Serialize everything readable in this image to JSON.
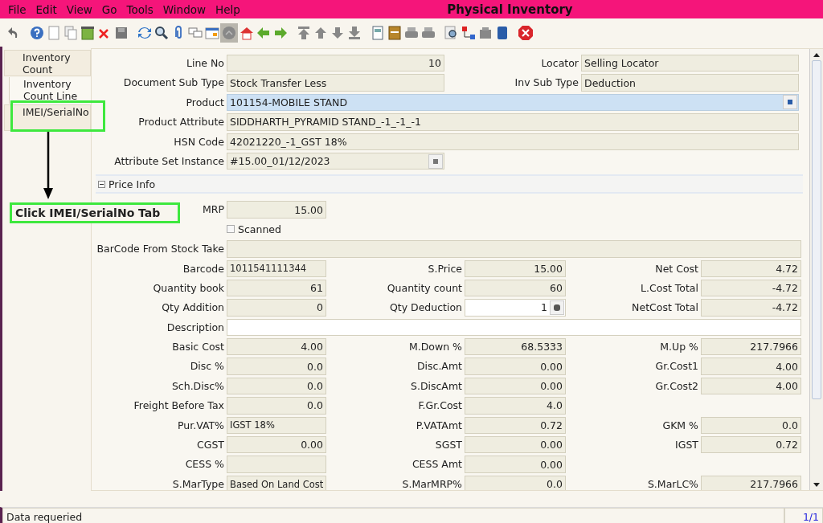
{
  "window": {
    "title": "Physical Inventory"
  },
  "menu": [
    {
      "label": "File"
    },
    {
      "label": "Edit"
    },
    {
      "label": "View"
    },
    {
      "label": "Go"
    },
    {
      "label": "Tools"
    },
    {
      "label": "Window"
    },
    {
      "label": "Help"
    }
  ],
  "toolbar": {
    "buttons": [
      {
        "pressed": false
      },
      {
        "pressed": false
      },
      {
        "pressed": false
      },
      {
        "pressed": false
      },
      {
        "pressed": false
      },
      {
        "pressed": false
      },
      {
        "pressed": false
      },
      {
        "pressed": false
      },
      {
        "pressed": false
      },
      {
        "pressed": false
      },
      {
        "pressed": false
      },
      {
        "pressed": false
      },
      {
        "pressed": true
      },
      {
        "pressed": false
      },
      {
        "pressed": false
      },
      {
        "pressed": false
      },
      {
        "pressed": false
      },
      {
        "pressed": false
      },
      {
        "pressed": false
      },
      {
        "pressed": false
      },
      {
        "pressed": false
      },
      {
        "pressed": false
      },
      {
        "pressed": false
      },
      {
        "pressed": false
      },
      {
        "pressed": false
      },
      {
        "pressed": false
      },
      {
        "pressed": false
      },
      {
        "pressed": false
      },
      {
        "pressed": false
      }
    ]
  },
  "tabs": [
    {
      "label": "Inventory Count",
      "selected": false
    },
    {
      "label": "Inventory Count Line",
      "selected": true
    },
    {
      "label": "IMEI/SerialNo",
      "selected": false
    }
  ],
  "annotation": {
    "text": "Click IMEI/SerialNo Tab"
  },
  "form": {
    "top_rows": [
      {
        "left": {
          "label": "Line No",
          "value": "10",
          "kind": "number",
          "editable": false
        },
        "right": {
          "label": "Locator",
          "value": "Selling Locator",
          "kind": "text",
          "editable": false
        }
      },
      {
        "left": {
          "label": "Document Sub Type",
          "value": "Stock Transfer Less",
          "kind": "text",
          "editable": false
        },
        "right": {
          "label": "Inv Sub Type",
          "value": "Deduction",
          "kind": "text",
          "editable": false
        }
      },
      {
        "left": {
          "label": "Product",
          "value": "101154-MOBILE STAND",
          "kind": "lookup",
          "editable": false,
          "focused": true,
          "wide": true
        }
      },
      {
        "left": {
          "label": "Product Attribute",
          "value": "SIDDHARTH_PYRAMID STAND_-1_-1_-1",
          "kind": "text",
          "editable": false,
          "wide": true
        }
      },
      {
        "left": {
          "label": "HSN Code",
          "value": "42021220_-1_GST 18%",
          "kind": "text",
          "editable": false,
          "wide": true
        }
      },
      {
        "left": {
          "label": "Attribute Set Instance",
          "value": "#15.00_01/12/2023",
          "kind": "lookup",
          "editable": false
        }
      }
    ],
    "section": {
      "title": "Price Info",
      "expanded": true
    },
    "rows": [
      {
        "left": {
          "label": "MRP",
          "value": "15.00",
          "kind": "number",
          "editable": false
        }
      },
      {
        "left": {
          "kind": "checkbox",
          "label": "Scanned",
          "checked": false
        }
      },
      {
        "left": {
          "label": "BarCode From Stock Take",
          "kind": "text",
          "editable": false,
          "wide": true
        }
      },
      {
        "left": {
          "label": "Barcode",
          "value": "1011541111344",
          "kind": "text",
          "editable": false
        },
        "middle": {
          "label": "S.Price",
          "value": "15.00",
          "kind": "number",
          "editable": false
        },
        "right": {
          "label": "Net Cost",
          "value": "4.72",
          "kind": "number",
          "editable": false
        }
      },
      {
        "left": {
          "label": "Quantity book",
          "value": "61",
          "kind": "number",
          "editable": false
        },
        "middle": {
          "label": "Quantity count",
          "value": "60",
          "kind": "number",
          "editable": false
        },
        "right": {
          "label": "L.Cost Total",
          "value": "-4.72",
          "kind": "number",
          "editable": false
        }
      },
      {
        "left": {
          "label": "Qty Addition",
          "value": "0",
          "kind": "number",
          "editable": false
        },
        "middle": {
          "label": "Qty Deduction",
          "value": "1",
          "kind": "spinner",
          "editable": true
        },
        "right": {
          "label": "NetCost Total",
          "value": "-4.72",
          "kind": "number",
          "editable": false
        }
      },
      {
        "left": {
          "label": "Description",
          "kind": "text",
          "editable": true,
          "wide": true
        }
      },
      {
        "left": {
          "label": "Basic Cost",
          "value": "4.00",
          "kind": "number",
          "editable": false
        },
        "middle": {
          "label": "M.Down %",
          "value": "68.5333",
          "kind": "number",
          "editable": false
        },
        "right": {
          "label": "M.Up %",
          "value": "217.7966",
          "kind": "number",
          "editable": false
        }
      },
      {
        "left": {
          "label": "Disc %",
          "value": "0.0",
          "kind": "number",
          "editable": false
        },
        "middle": {
          "label": "Disc.Amt",
          "value": "0.00",
          "kind": "number",
          "editable": false
        },
        "right": {
          "label": "Gr.Cost1",
          "value": "4.00",
          "kind": "number",
          "editable": false
        }
      },
      {
        "left": {
          "label": "Sch.Disc%",
          "value": "0.0",
          "kind": "number",
          "editable": false
        },
        "middle": {
          "label": "S.DiscAmt",
          "value": "0.00",
          "kind": "number",
          "editable": false
        },
        "right": {
          "label": "Gr.Cost2",
          "value": "4.00",
          "kind": "number",
          "editable": false
        }
      },
      {
        "left": {
          "label": "Freight Before Tax",
          "value": "0.0",
          "kind": "number",
          "editable": false
        },
        "middle": {
          "label": "F.Gr.Cost",
          "value": "4.0",
          "kind": "number",
          "editable": false
        }
      },
      {
        "left": {
          "label": "Pur.VAT%",
          "value": "IGST 18%",
          "kind": "text",
          "editable": false
        },
        "middle": {
          "label": "P.VATAmt",
          "value": "0.72",
          "kind": "number",
          "editable": false
        },
        "right": {
          "label": "GKM %",
          "value": "0.0",
          "kind": "number",
          "editable": false
        }
      },
      {
        "left": {
          "label": "CGST",
          "value": "0.00",
          "kind": "number",
          "editable": false
        },
        "middle": {
          "label": "SGST",
          "value": "0.00",
          "kind": "number",
          "editable": false
        },
        "right": {
          "label": "IGST",
          "value": "0.72",
          "kind": "number",
          "editable": false
        }
      },
      {
        "left": {
          "label": "CESS %",
          "kind": "number",
          "editable": false
        },
        "middle": {
          "label": "CESS Amt",
          "value": "0.00",
          "kind": "number",
          "editable": false
        }
      },
      {
        "left": {
          "label": "S.MarType",
          "value": "Based On Land Cost",
          "kind": "text",
          "editable": false
        },
        "middle": {
          "label": "S.MarMRP%",
          "value": "0.0",
          "kind": "number",
          "editable": false
        },
        "right": {
          "label": "S.MarLC%",
          "value": "217.7966",
          "kind": "number",
          "editable": false
        }
      }
    ]
  },
  "status_bar": {
    "message": "Data requeried",
    "record": "1/1"
  }
}
